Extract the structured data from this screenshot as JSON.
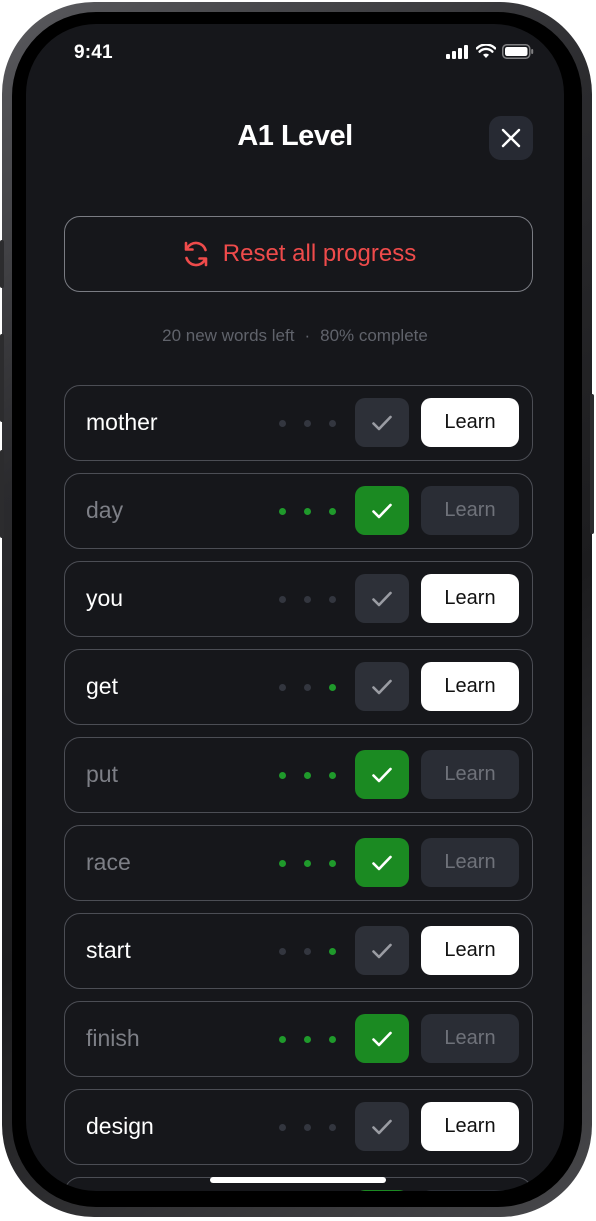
{
  "status_bar": {
    "time": "9:41",
    "icons": [
      "signal-icon",
      "wifi-icon",
      "battery-icon"
    ]
  },
  "header": {
    "title": "A1 Level",
    "close_icon": "close-icon"
  },
  "reset": {
    "label": "Reset all progress",
    "icon": "refresh-icon",
    "color": "#ef4b4b"
  },
  "summary": {
    "words_left": "20 new words left",
    "separator": "·",
    "complete": "80% complete"
  },
  "colors": {
    "background": "#16171b",
    "accent_green": "#1b8a22",
    "dot_green": "#1f9a2b",
    "danger": "#ef4b4b"
  },
  "learn_label": "Learn",
  "words": [
    {
      "word": "mother",
      "progress": 0,
      "known": false
    },
    {
      "word": "day",
      "progress": 3,
      "known": true
    },
    {
      "word": "you",
      "progress": 0,
      "known": false
    },
    {
      "word": "get",
      "progress": 1,
      "known": false
    },
    {
      "word": "put",
      "progress": 3,
      "known": true
    },
    {
      "word": "race",
      "progress": 3,
      "known": true
    },
    {
      "word": "start",
      "progress": 1,
      "known": false
    },
    {
      "word": "finish",
      "progress": 3,
      "known": true
    },
    {
      "word": "design",
      "progress": 0,
      "known": false
    }
  ]
}
